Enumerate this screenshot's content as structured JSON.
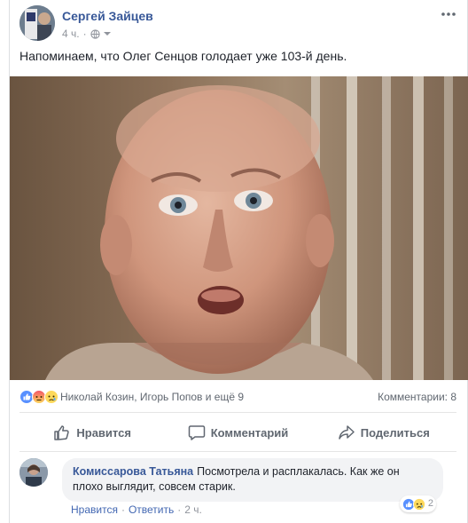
{
  "post": {
    "author": "Сергей Зайцев",
    "time": "4 ч.",
    "text": "Напоминаем, что Олег Сенцов голодает уже 103-й день."
  },
  "reactions": {
    "icons": [
      "like-icon",
      "angry-icon",
      "sad-icon"
    ],
    "names": "Николай Козин, Игорь Попов и ещё 9",
    "comments_count": "Комментарии: 8"
  },
  "actions": {
    "like": "Нравится",
    "comment": "Комментарий",
    "share": "Поделиться"
  },
  "comment": {
    "author": "Комиссарова Татьяна",
    "text": "Посмотрела и расплакалась. Как же он плохо выглядит, совсем старик.",
    "reaction_count": "2",
    "like_label": "Нравится",
    "reply_label": "Ответить",
    "time": "2 ч.",
    "separator": "·"
  },
  "colors": {
    "link_blue": "#385898",
    "like_blue": "#4267b2",
    "muted": "#606770",
    "bubble_bg": "#f2f3f5"
  }
}
